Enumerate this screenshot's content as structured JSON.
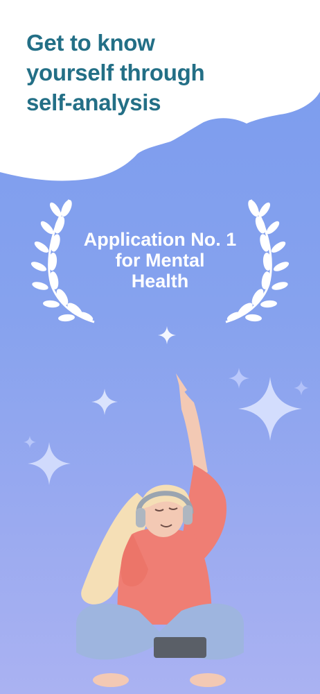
{
  "headline": {
    "line1": "Get to know",
    "line2": "yourself through",
    "line3": "self-analysis"
  },
  "award": {
    "line1": "Application No. 1",
    "line2": "for Mental",
    "line3": "Health"
  },
  "colors": {
    "headline": "#236f86",
    "background_top": "#7a9bee",
    "background_bottom": "#aab2f2",
    "cloud": "#ffffff",
    "award_text": "#ffffff"
  },
  "icons": [
    "laurel-left-icon",
    "laurel-right-icon",
    "sparkle-icon"
  ]
}
